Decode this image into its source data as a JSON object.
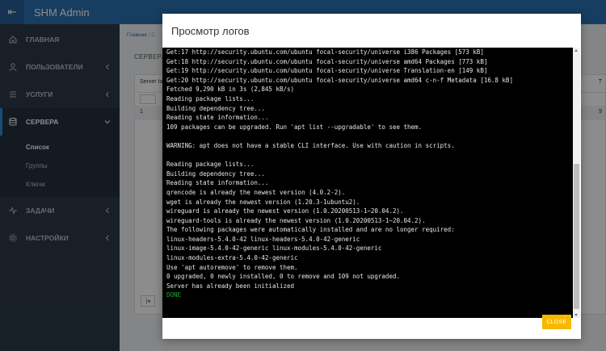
{
  "app": {
    "title": "SHM Admin"
  },
  "sidebar": {
    "items": [
      {
        "label": "ГЛАВНАЯ",
        "icon": "home-icon"
      },
      {
        "label": "ПОЛЬЗОВАТЕЛИ",
        "icon": "user-icon"
      },
      {
        "label": "УСЛУГИ",
        "icon": "list-icon"
      },
      {
        "label": "СЕРВЕРА",
        "icon": "database-icon"
      },
      {
        "label": "ЗАДАЧИ",
        "icon": "activity-icon"
      },
      {
        "label": "НАСТРОЙКИ",
        "icon": "gear-icon"
      }
    ],
    "subitems": [
      {
        "label": "Список"
      },
      {
        "label": "Группы"
      },
      {
        "label": "Ключи"
      }
    ]
  },
  "content": {
    "breadcrumb": "Главная",
    "breadcrumb_tail": "С",
    "section_title": "СЕРВЕРА",
    "table": {
      "first_header": "Server Id",
      "first_header_visible": "Server Io",
      "last_header": "T",
      "first_cell": "1",
      "last_cell": "9"
    }
  },
  "modal": {
    "title": "Просмотр логов",
    "close_label": "CLOSE",
    "log_lines": [
      "Get:17 http://security.ubuntu.com/ubuntu focal-security/universe i386 Packages [573 kB]",
      "Get:18 http://security.ubuntu.com/ubuntu focal-security/universe amd64 Packages [773 kB]",
      "Get:19 http://security.ubuntu.com/ubuntu focal-security/universe Translation-en [149 kB]",
      "Get:20 http://security.ubuntu.com/ubuntu focal-security/universe amd64 c-n-f Metadata [16.8 kB]",
      "Fetched 9,290 kB in 3s (2,845 kB/s)",
      "Reading package lists...",
      "Building dependency tree...",
      "Reading state information...",
      "109 packages can be upgraded. Run 'apt list --upgradable' to see them.",
      "",
      "WARNING: apt does not have a stable CLI interface. Use with caution in scripts.",
      "",
      "Reading package lists...",
      "Building dependency tree...",
      "Reading state information...",
      "qrencode is already the newest version (4.0.2-2).",
      "wget is already the newest version (1.20.3-1ubuntu2).",
      "wireguard is already the newest version (1.0.20200513-1~20.04.2).",
      "wireguard-tools is already the newest version (1.0.20200513-1~20.04.2).",
      "The following packages were automatically installed and are no longer required:",
      "linux-headers-5.4.0-42 linux-headers-5.4.0-42-generic",
      "linux-image-5.4.0-42-generic linux-modules-5.4.0-42-generic",
      "linux-modules-extra-5.4.0-42-generic",
      "Use 'apt autoremove' to remove them.",
      "0 upgraded, 0 newly installed, 0 to remove and 109 not upgraded.",
      "Server has already been initialized"
    ],
    "status_line": "DONE"
  },
  "colors": {
    "header_blue": "#2b6fb0",
    "sidebar_bg": "#2c3a47",
    "done_green": "#25a52d",
    "close_button": "#f6b800"
  }
}
